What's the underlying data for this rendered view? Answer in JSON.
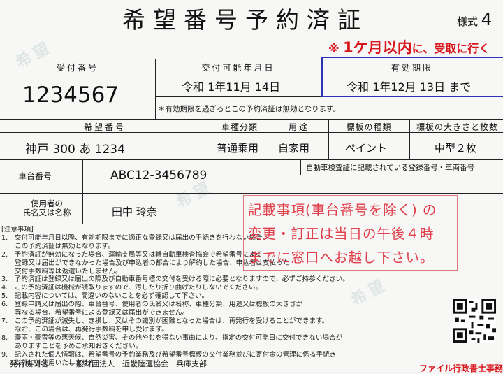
{
  "title": "希望番号予約済証",
  "style_label": "様式",
  "style_number": "4",
  "notice": {
    "mark": "※",
    "highlight": "1ケ月以内",
    "rest": "に、受取に行く"
  },
  "headers": {
    "receipt_no": "受付番号",
    "delivery_date": "交付可能年月日",
    "expiry": "有効期限",
    "plate_no": "希望番号",
    "vehicle_class": "車種分類",
    "usage": "用途",
    "plate_type": "標板の種類",
    "plate_size": "標板の大きさと枚数",
    "chassis_no": "車台番号",
    "owner_line1": "使用者の",
    "owner_line2": "氏名又は名称"
  },
  "values": {
    "receipt_no": "1234567",
    "delivery_date": "令和 1年11月 14日",
    "expiry": "令和 1年12月 13日 まで",
    "expiry_note": "＊有効期限を過ぎるとこの予約済証は無効となります。",
    "plate_no": "神戸 300 あ 1234",
    "vehicle_class": "普通乗用",
    "usage": "自家用",
    "plate_type": "ペイント",
    "plate_size": "中型２枚",
    "chassis_note": "自動車検査証に記載されている登録番号・車両番号",
    "chassis_no": "ABC12-3456789",
    "owner": "田中 玲奈"
  },
  "stamp": {
    "line1": "記載事項(車台番号を除く) の",
    "line2": "変更・訂正は当日の午後４時",
    "line3": "までに窓口へお越し下さい。"
  },
  "notes": {
    "heading": "[注意事項]",
    "items": [
      "1.　交付可能年月日以降、有効期限までに適正な登録又は届出の手続きを行わない場合、",
      "　　この予約済証は無効となります。",
      "2.　予約済証が無効になった場合、運輸支局等又は軽自動車検査協会で希望番号による",
      "　　登録又は届出ができなかった場合及び申込者の都合により解約した場合、申込者は支払った",
      "　　交付手数料等は返還いたしません。",
      "3.　予約済証は登録又は届出の際及び自動車番号標の交付を受ける際に必要となりますので、必ずご持参ください。",
      "4.　この予約済証は機械が読取りますので、汚したり折り曲げたりしないでください。",
      "5.　記載内容については、間違いのないことを必ず確認して下さい。",
      "6.　登録申請又は届出の際、車台番号、使用者の氏名又は名称、車種分類、用途又は標板の大きさが",
      "　　異なる場合、希望番号による登録又は届出ができません。",
      "7.　この予約済証が減失し、き損し、又はその識別が困難となった場合は、再発行を受けることができます。",
      "　　なお、この場合は、再発行手数料を申し受けます。",
      "8.　豪雨・豪雪等の悪天候、自然災害、その他やむを得ない事由により、指定の交付可能日に交付できない場合が",
      "　　ありますことを予めご承知おきください。",
      "9.　記入された個人情報は、希望番号の予約業務及び希望番号標板の交付業務並びに寄付金の管理に係る手続き",
      "　　以外には使用いたしません。"
    ]
  },
  "issuer": {
    "label": "発行機関名：",
    "name": "一般財団法人　近畿陸運協会　兵庫支部"
  },
  "footer_cut": "ファイル行政書士事務",
  "colors": {
    "accent_red": "#d8161e",
    "accent_blue": "#2a34b5",
    "stamp_red": "#e0404c"
  }
}
